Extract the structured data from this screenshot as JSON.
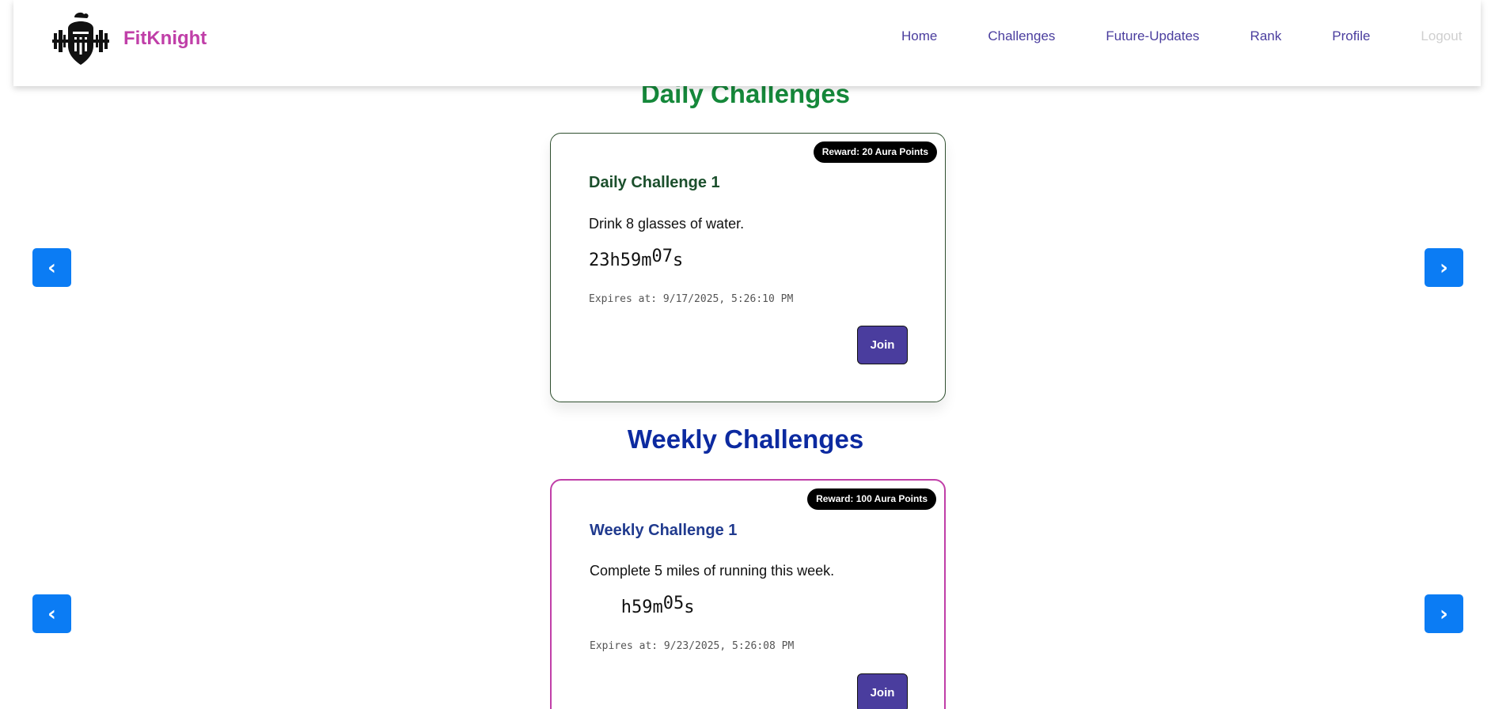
{
  "brand": {
    "name": "FitKnight",
    "logo_icon": "knight-helmet-dumbbell-icon"
  },
  "nav": {
    "links": [
      "Home",
      "Challenges",
      "Future-Updates",
      "Rank",
      "Profile"
    ],
    "logout": "Logout"
  },
  "daily": {
    "section_title": "Daily Challenges",
    "card": {
      "reward": "Reward: 20 Aura Points",
      "title": "Daily Challenge 1",
      "description": "Drink 8 glasses of water.",
      "timer_main": "23h59m",
      "timer_seconds": "07",
      "timer_suffix": "s",
      "expires": "Expires at: 9/17/2025, 5:26:10 PM",
      "join_label": "Join"
    },
    "prev_label": "‹",
    "next_label": "›"
  },
  "weekly": {
    "section_title": "Weekly Challenges",
    "card": {
      "reward": "Reward: 100 Aura Points",
      "title": "Weekly Challenge 1",
      "description": "Complete 5 miles of running this week.",
      "timer_main": "   h59m",
      "timer_seconds": "05",
      "timer_suffix": "s",
      "expires": "Expires at: 9/23/2025, 5:26:08 PM",
      "join_label": "Join"
    },
    "prev_label": "‹",
    "next_label": "›"
  },
  "colors": {
    "brand": "#c03fa8",
    "nav_link": "#4a3d9e",
    "daily_title": "#15883a",
    "weekly_title": "#0c2aa0",
    "arrow": "#0b7cf4",
    "join": "#4a3d9e"
  }
}
